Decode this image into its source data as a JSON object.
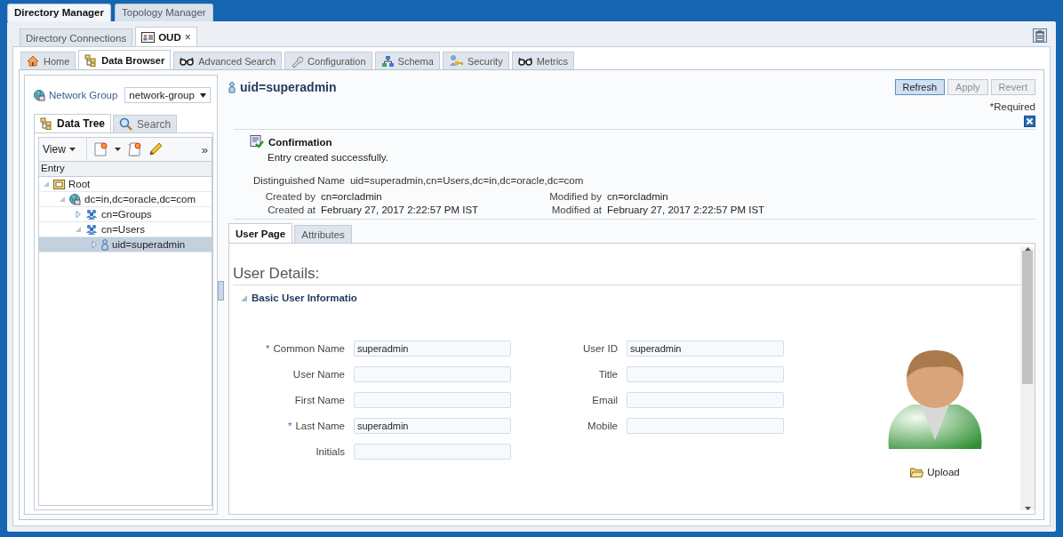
{
  "app_tabs": [
    {
      "label": "Directory Manager",
      "selected": true
    },
    {
      "label": "Topology Manager",
      "selected": false
    }
  ],
  "doc_tabs": [
    {
      "label": "Directory Connections",
      "selected": false,
      "kind": "plain"
    },
    {
      "label": "OUD",
      "selected": true,
      "close": "×",
      "kind": "card"
    }
  ],
  "nav_tabs": [
    {
      "label": "Home",
      "kind": "home",
      "selected": false
    },
    {
      "label": "Data Browser",
      "kind": "tree",
      "selected": true
    },
    {
      "label": "Advanced Search",
      "kind": "glasses",
      "selected": false
    },
    {
      "label": "Configuration",
      "kind": "wrench",
      "selected": false
    },
    {
      "label": "Schema",
      "kind": "schema",
      "selected": false
    },
    {
      "label": "Security",
      "kind": "key",
      "selected": false
    },
    {
      "label": "Metrics",
      "kind": "glasses",
      "selected": false
    }
  ],
  "left": {
    "network_group": {
      "label": "Network Group",
      "value": "network-group"
    },
    "tabs": [
      {
        "label": "Data Tree",
        "kind": "tree",
        "selected": true
      },
      {
        "label": "Search",
        "kind": "search",
        "selected": false
      }
    ],
    "toolbar": {
      "view": "View",
      "more": "»"
    },
    "tree": {
      "header": "Entry",
      "items": [
        {
          "label": "Root",
          "kind": "folder",
          "expanded": true,
          "selected": false,
          "children": [
            {
              "label": "dc=in,dc=oracle,dc=com",
              "kind": "globe",
              "expanded": true,
              "selected": false,
              "children": [
                {
                  "label": "cn=Groups",
                  "kind": "group",
                  "expanded": false,
                  "selected": false
                },
                {
                  "label": "cn=Users",
                  "kind": "group",
                  "expanded": true,
                  "selected": false,
                  "children": [
                    {
                      "label": "uid=superadmin",
                      "kind": "user",
                      "expanded": false,
                      "selected": true
                    }
                  ]
                }
              ]
            }
          ]
        }
      ]
    }
  },
  "entry": {
    "title": "uid=superadmin",
    "buttons": [
      {
        "label": "Refresh",
        "disabled": false,
        "focused": true
      },
      {
        "label": "Apply",
        "disabled": true,
        "focused": false
      },
      {
        "label": "Revert",
        "disabled": true,
        "focused": false
      }
    ],
    "required_note": "*Required",
    "confirmation": {
      "title": "Confirmation",
      "message": "Entry created successfully."
    },
    "dn": {
      "label": "Distinguished Name",
      "value": "uid=superadmin,cn=Users,dc=in,dc=oracle,dc=com"
    },
    "meta": [
      {
        "label": "Created by",
        "value": "cn=orcladmin"
      },
      {
        "label": "Modified by",
        "value": "cn=orcladmin"
      },
      {
        "label": "Created at",
        "value": "February 27, 2017 2:22:57 PM IST"
      },
      {
        "label": "Modified at",
        "value": "February 27, 2017 2:22:57 PM IST"
      }
    ],
    "tabs": [
      {
        "label": "User Page",
        "selected": true
      },
      {
        "label": "Attributes",
        "selected": false
      }
    ],
    "heading": "User Details:",
    "section": {
      "title": "Basic User Informatio",
      "expanded": true
    },
    "fields_left": [
      {
        "label": "Common Name",
        "required_mark": "*",
        "value": "superadmin"
      },
      {
        "label": "User Name"
      },
      {
        "label": "First Name"
      },
      {
        "label": "Last Name",
        "required_mark": "*",
        "value": "superadmin"
      },
      {
        "label": "Initials"
      }
    ],
    "fields_right": [
      {
        "label": "User ID",
        "value": "superadmin"
      },
      {
        "label": "Title"
      },
      {
        "label": "Email"
      },
      {
        "label": "Mobile"
      }
    ],
    "upload": "Upload"
  }
}
